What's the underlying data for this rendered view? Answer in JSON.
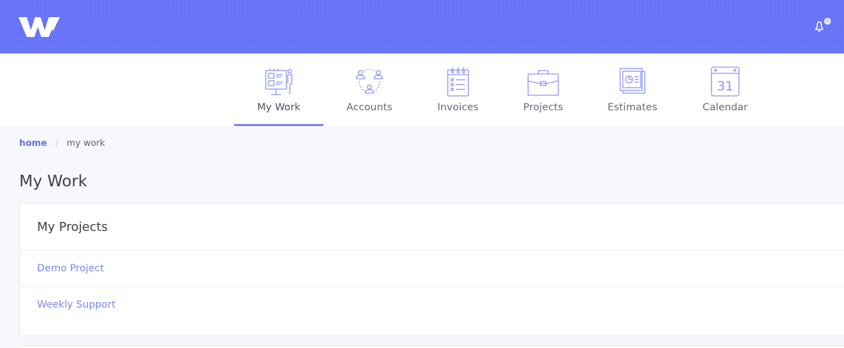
{
  "brand": {
    "logo_text": "W",
    "header_color": "#6874f8"
  },
  "header": {
    "notification_icon": "bell-icon"
  },
  "nav": {
    "items": [
      {
        "label": "My Work",
        "icon": "my-work-icon",
        "active": true
      },
      {
        "label": "Accounts",
        "icon": "accounts-icon",
        "active": false
      },
      {
        "label": "Invoices",
        "icon": "invoices-icon",
        "active": false
      },
      {
        "label": "Projects",
        "icon": "projects-icon",
        "active": false
      },
      {
        "label": "Estimates",
        "icon": "estimates-icon",
        "active": false
      },
      {
        "label": "Calendar",
        "icon": "calendar-icon",
        "active": false,
        "icon_text": "31"
      }
    ]
  },
  "breadcrumb": {
    "home": "home",
    "separator": "/",
    "current": "my work"
  },
  "page": {
    "title": "My Work"
  },
  "projects_card": {
    "title": "My Projects",
    "projects": [
      {
        "name": "Demo Project"
      },
      {
        "name": "Weekly Support"
      }
    ]
  }
}
